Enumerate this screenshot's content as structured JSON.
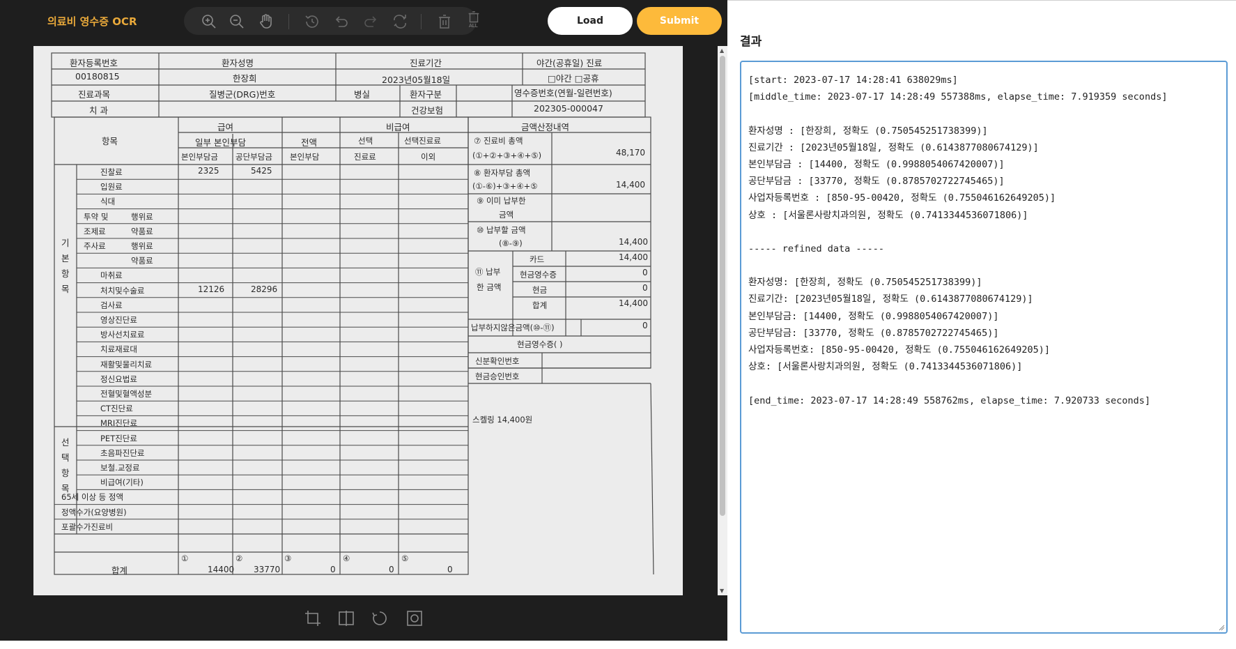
{
  "app": {
    "title": "의료비 영수증 OCR"
  },
  "toolbar": {
    "tools": [
      "zoom-in-icon",
      "zoom-out-icon",
      "hand-pan-icon",
      "history-icon",
      "undo-icon",
      "redo-icon",
      "reset-icon",
      "delete-icon",
      "delete-all-icon"
    ],
    "delete_all_text": "ALL",
    "load_label": "Load",
    "submit_label": "Submit",
    "accent_color": "#fdba3b",
    "title_color": "#e9a93a"
  },
  "bottom_tools": [
    "crop-icon",
    "flip-icon",
    "rotate-icon",
    "draw-shape-icon"
  ],
  "receipt": {
    "header": {
      "reg_no_label": "환자등록번호",
      "reg_no": "00180815",
      "name_label": "환자성명",
      "name": "한장희",
      "period_label": "진료기간",
      "period": "2023년05월18일",
      "night_label": "야간(공휴일) 진료",
      "night_opts": "□야간 □공휴",
      "dept_label": "진료과목",
      "drg_label": "질병군(DRG)번호",
      "room_label": "병실",
      "ptype_label": "환자구분",
      "ptype": "건강보험",
      "receipt_no_label": "영수증번호(연월-일련번호)",
      "receipt_no": "202305-000047",
      "dept": "치 과"
    },
    "cols": {
      "item": "항목",
      "insured": "급여",
      "partial": "일부 본인부담",
      "self_pay": "본인부담금",
      "public_pay": "공단부담금",
      "full": "전액",
      "full_self": "본인부담",
      "uninsured": "비급여",
      "select": "선택",
      "select_fee": "진료료",
      "select_other": "선택진료료",
      "select_other2": "이외",
      "calc": "금액산정내역"
    },
    "group_basic": [
      "기",
      "본",
      "항",
      "목"
    ],
    "group_select": [
      "선",
      "택",
      "항",
      "목"
    ],
    "rows": [
      {
        "label": "진찰료",
        "self": "2325",
        "public": "5425"
      },
      {
        "label": "입원료",
        "self": "",
        "public": ""
      },
      {
        "label": "식대",
        "self": "",
        "public": ""
      },
      {
        "label": "투약 및",
        "sub": "행위료",
        "self": "",
        "public": ""
      },
      {
        "label": "조제료",
        "sub": "약품료",
        "self": "",
        "public": ""
      },
      {
        "label": "주사료",
        "sub": "행위료",
        "self": "",
        "public": ""
      },
      {
        "label": "",
        "sub": "약품료",
        "self": "",
        "public": ""
      },
      {
        "label": "마취료",
        "self": "",
        "public": ""
      },
      {
        "label": "처치및수술료",
        "self": "12126",
        "public": "28296"
      },
      {
        "label": "검사료",
        "self": "",
        "public": ""
      },
      {
        "label": "영상진단료",
        "self": "",
        "public": ""
      },
      {
        "label": "방사선치료료",
        "self": "",
        "public": ""
      },
      {
        "label": "치료재료대",
        "self": "",
        "public": ""
      },
      {
        "label": "재활및물리치료",
        "self": "",
        "public": ""
      },
      {
        "label": "정신요법료",
        "self": "",
        "public": ""
      },
      {
        "label": "전혈및혈액성분",
        "self": "",
        "public": ""
      },
      {
        "label": "CT진단료",
        "self": "",
        "public": ""
      },
      {
        "label": "MRI진단료",
        "self": "",
        "public": ""
      },
      {
        "label": "PET진단료",
        "self": "",
        "public": ""
      },
      {
        "label": "초음파진단료",
        "self": "",
        "public": ""
      },
      {
        "label": "보철.교정료",
        "self": "",
        "public": ""
      },
      {
        "label": "비급여(기타)",
        "self": "",
        "public": ""
      },
      {
        "label": "65세 이상 등 정액",
        "self": "",
        "public": ""
      },
      {
        "label": "정액수가(요양병원)",
        "self": "",
        "public": ""
      },
      {
        "label": "포괄수가진료비",
        "self": "",
        "public": ""
      }
    ],
    "total": {
      "label": "합계",
      "n1": "①",
      "v1": "14400",
      "n2": "②",
      "v2": "33770",
      "n3": "③",
      "v3": "0",
      "n4": "④",
      "v4": "0",
      "n5": "⑤",
      "v5": "0"
    },
    "calc": {
      "total_label": "⑦ 진료비 총액",
      "total_formula": "(①+②+③+④+⑤)",
      "total_value": "48,170",
      "patient_label": "⑧ 환자부담 총액",
      "patient_formula": "(①-⑥)+③+④+⑤",
      "patient_value": "14,400",
      "paid_label": "⑨ 이미 납부한",
      "paid_label2": "금액",
      "due_label": "⑩ 납부할 금액",
      "due_formula": "(⑧-⑨)",
      "due_value": "14,400",
      "pay_label": "⑪ 납부",
      "pay_label2": "한 금액",
      "card_label": "카드",
      "card_value": "14,400",
      "cash_receipt_label": "현금영수증",
      "cash_receipt_value": "0",
      "cash_label": "현금",
      "cash_value": "0",
      "sum_label": "합계",
      "sum_value": "14,400",
      "unpaid_label": "납부하지않은금액(⑩-⑪)",
      "unpaid_value": "0",
      "cr_title": "현금영수증(           )",
      "id_label": "신분확인번호",
      "approve_label": "현금승인번호",
      "note": "스켈링 14,400원"
    }
  },
  "result": {
    "label": "결과",
    "lines": [
      "[start: 2023-07-17 14:28:41 638029ms]",
      "[middle_time: 2023-07-17 14:28:49 557388ms, elapse_time: 7.919359 seconds]",
      "",
      "환자성명 : [한장희, 정확도 (0.750545251738399)]",
      "진료기간 : [2023년05월18일, 정확도 (0.6143877080674129)]",
      "본인부담금 : [14400, 정확도 (0.9988054067420007)]",
      "공단부담금 : [33770, 정확도 (0.8785702722745465)]",
      "사업자등록번호 : [850-95-00420, 정확도 (0.755046162649205)]",
      "상호 : [서울론사랑치과의원, 정확도 (0.7413344536071806)]",
      "",
      "----- refined data -----",
      "",
      "환자성명: [한장희, 정확도 (0.750545251738399)]",
      "진료기간: [2023년05월18일, 정확도 (0.6143877080674129)]",
      "본인부담금: [14400, 정확도 (0.9988054067420007)]",
      "공단부담금: [33770, 정확도 (0.8785702722745465)]",
      "사업자등록번호: [850-95-00420, 정확도 (0.755046162649205)]",
      "상호: [서울론사랑치과의원, 정확도 (0.7413344536071806)]",
      "",
      "[end_time: 2023-07-17 14:28:49 558762ms, elapse_time: 7.920733 seconds]"
    ]
  }
}
